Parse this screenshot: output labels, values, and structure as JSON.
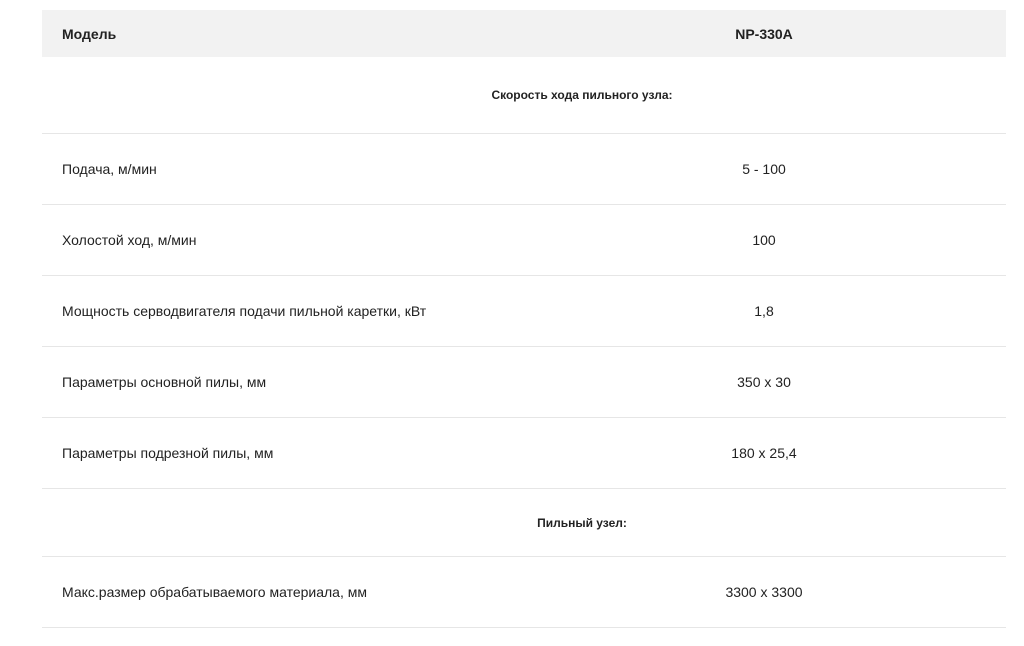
{
  "table": {
    "header": {
      "label": "Модель",
      "value": "NP-330A"
    },
    "sections": [
      {
        "title": "Скорость хода пильного узла:",
        "rows": [
          {
            "label": "Подача, м/мин",
            "value": "5 - 100"
          },
          {
            "label": "Холостой ход, м/мин",
            "value": "100"
          },
          {
            "label": "Мощность серводвигателя подачи пильной каретки, кВт",
            "value": "1,8"
          },
          {
            "label": "Параметры основной пилы, мм",
            "value": "350 x 30"
          },
          {
            "label": "Параметры подрезной пилы, мм",
            "value": "180 x 25,4"
          }
        ]
      },
      {
        "title": "Пильный узел:",
        "rows": [
          {
            "label": "Макс.размер обрабатываемого материала, мм",
            "value": "3300 x 3300"
          }
        ]
      }
    ]
  }
}
